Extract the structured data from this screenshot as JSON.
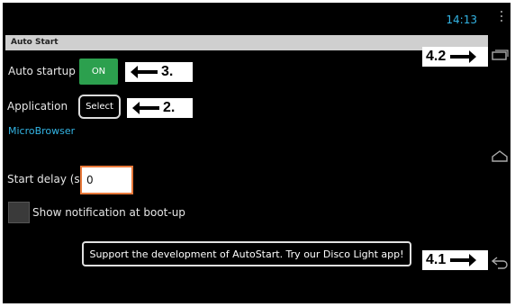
{
  "status_bar": {
    "time": "14:13"
  },
  "app": {
    "title": "Auto Start"
  },
  "settings": {
    "auto_startup_label": "Auto startup",
    "auto_startup_toggle": "ON",
    "application_label": "Application",
    "select_button": "Select",
    "selected_app": "MicroBrowser",
    "start_delay_label": "Start delay (s)",
    "start_delay_value": "0",
    "show_notification_label": "Show notification at boot-up",
    "show_notification_checked": false
  },
  "toast": {
    "text": "Support the development of AutoStart. Try our Disco Light app!"
  },
  "callouts": {
    "toggle_marker": "3.",
    "select_marker": "2.",
    "recent_apps_marker": "4.2",
    "back_marker": "4.1"
  },
  "icons": {
    "recent_apps": "recent-apps-icon",
    "home": "home-icon",
    "back": "back-icon",
    "overflow": "overflow-menu-icon"
  },
  "colors": {
    "accent": "#33b5e5",
    "toggle_on": "#2ca04e",
    "input_focus": "#e8793a",
    "title_bar": "#cfcfcf"
  }
}
